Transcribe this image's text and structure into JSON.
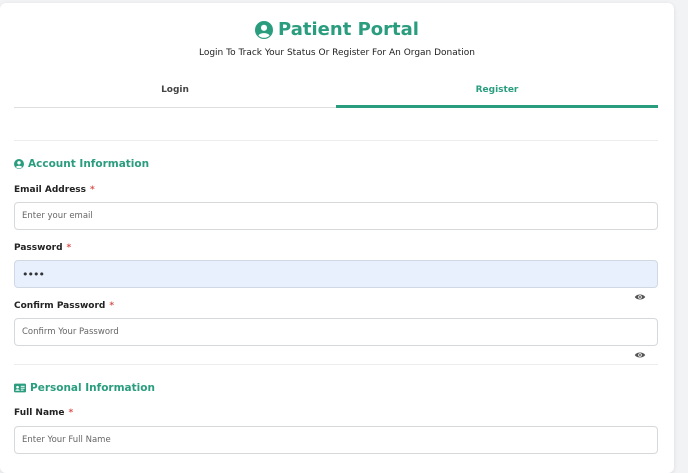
{
  "header": {
    "title": "Patient Portal",
    "subtitle": "Login To Track Your Status Or Register For An Organ Donation"
  },
  "tabs": [
    {
      "label": "Login",
      "active": false
    },
    {
      "label": "Register",
      "active": true
    }
  ],
  "sections": {
    "account": {
      "title": "Account Information",
      "icon": "user-circle-icon"
    },
    "personal": {
      "title": "Personal Information",
      "icon": "id-card-icon"
    }
  },
  "fields": {
    "email": {
      "label": "Email Address",
      "required_mark": "*",
      "placeholder": "Enter your email",
      "value": ""
    },
    "password": {
      "label": "Password",
      "required_mark": "*",
      "value": "••••"
    },
    "confirm_password": {
      "label": "Confirm Password",
      "required_mark": "*",
      "placeholder": "Confirm Your Password",
      "value": ""
    },
    "full_name": {
      "label": "Full Name",
      "required_mark": "*",
      "placeholder": "Enter Your Full Name",
      "value": ""
    }
  },
  "colors": {
    "accent": "#2a9d7f",
    "required": "#d9534f",
    "autofill": "#e8f0fe"
  }
}
